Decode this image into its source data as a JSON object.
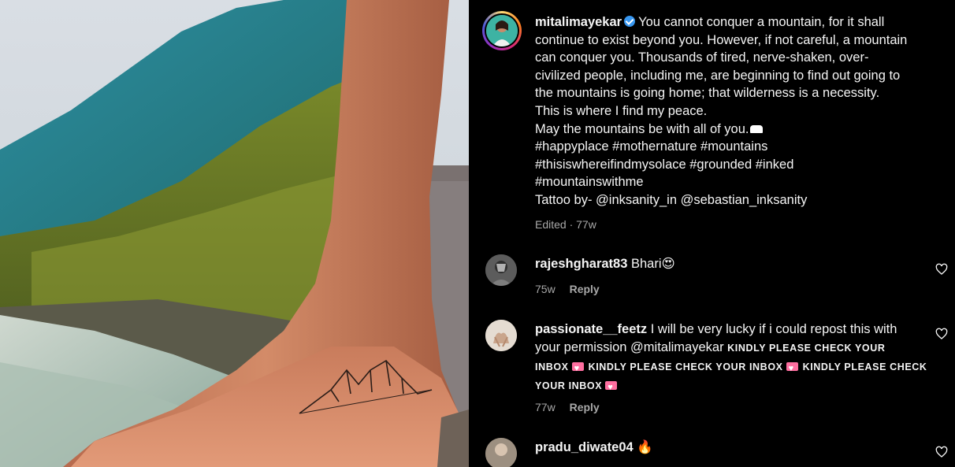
{
  "post": {
    "username": "mitalimayekar",
    "caption_lines": [
      "You cannot conquer a mountain, for it shall",
      "continue to exist beyond you. However, if not careful, a mountain",
      "can conquer you. Thousands of tired, nerve-shaken, over-",
      "civilized people, including me, are beginning to find out going to",
      "the mountains is going home; that wilderness is a necessity.",
      "This is where I find my peace.",
      "May the mountains be with all of you.",
      "#happyplace #mothernature #mountains",
      "#thisiswhereifindmysolace #grounded #inked",
      "#mountainswithme",
      "Tattoo by- @inksanity_in @sebastian_inksanity"
    ],
    "meta": "Edited · 77w"
  },
  "comments": [
    {
      "username": "rajeshgharat83",
      "text": "Bhari",
      "emoji": "😍",
      "age": "75w",
      "reply_label": "Reply"
    },
    {
      "username": "passionate__feetz",
      "text_line1": "I will be very lucky if i could repost this with",
      "text_line2_prefix": "your permission @mitalimayekar",
      "shout1": "KINDLY PLEASE CHECK YOUR",
      "shout2": "INBOX",
      "shout3": "KINDLY PLEASE CHECK YOUR INBOX",
      "shout4": "KINDLY PLEASE CHECK",
      "shout5": "YOUR INBOX",
      "age": "77w",
      "reply_label": "Reply"
    },
    {
      "username": "pradu_diwate04",
      "emoji": "🔥"
    }
  ],
  "colors": {
    "background": "#000000",
    "text": "#f5f5f5",
    "secondary_text": "#a8a8a8",
    "verified_blue": "#3897f0"
  },
  "icons": [
    "verified-badge-icon",
    "heart-outline-icon",
    "pink-heart-emoji-icon",
    "hugging-face-emoji-icon",
    "fire-emoji-icon"
  ]
}
